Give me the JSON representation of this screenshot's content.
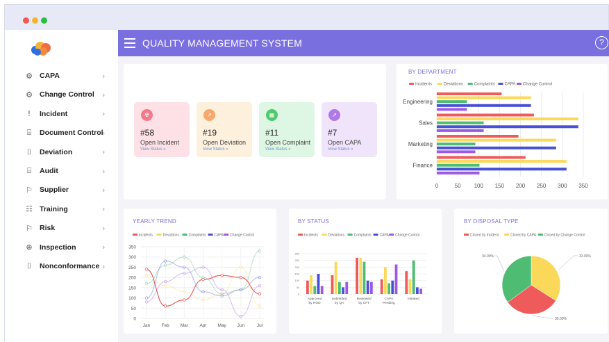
{
  "window": {
    "dots": [
      "#f05a4e",
      "#f5b52e",
      "#27c03f"
    ]
  },
  "header": {
    "title": "QUALITY MANAGEMENT SYSTEM",
    "help_symbol": "?"
  },
  "sidebar": {
    "items": [
      {
        "label": "CAPA",
        "icon": "gear-outline-icon"
      },
      {
        "label": "Change Control",
        "icon": "gear-icon"
      },
      {
        "label": "Incident",
        "icon": "exclamation-icon"
      },
      {
        "label": "Document Control",
        "icon": "document-icon"
      },
      {
        "label": "Deviation",
        "icon": "file-icon"
      },
      {
        "label": "Audit",
        "icon": "clipboard-icon"
      },
      {
        "label": "Supplier",
        "icon": "people-icon"
      },
      {
        "label": "Training",
        "icon": "chart-icon"
      },
      {
        "label": "Risk",
        "icon": "shield-icon"
      },
      {
        "label": "Inspection",
        "icon": "magnifier-icon"
      },
      {
        "label": "Nonconformance",
        "icon": "file-icon"
      }
    ]
  },
  "kpis": [
    {
      "count": "#58",
      "label": "Open Incident",
      "link": "View Status »",
      "bg": "#fde1e6",
      "icon_bg": "#f47a8b"
    },
    {
      "count": "#19",
      "label": "Open Deviation",
      "link": "View Status »",
      "bg": "#fdf0dc",
      "icon_bg": "#f8a86a"
    },
    {
      "count": "#11",
      "label": "Open Complaint",
      "link": "View Status »",
      "bg": "#ddf7e4",
      "icon_bg": "#4fc96d"
    },
    {
      "count": "#7",
      "label": "Open CAPA",
      "link": "View Status »",
      "bg": "#f0e4fb",
      "icon_bg": "#b07ae6"
    }
  ],
  "legend_colors": {
    "Incidents": "#ef5b5b",
    "Deviations": "#fad95a",
    "Complaints": "#4ebc72",
    "CAPA": "#4750d6",
    "Change Control": "#9d59e3"
  },
  "by_department": {
    "title": "BY DEPARTMENT",
    "series_names": [
      "Incidents",
      "Deviations",
      "Complaints",
      "CAPA",
      "Change Control"
    ],
    "x_ticks": [
      "0",
      "50",
      "100",
      "150",
      "200",
      "250",
      "300",
      "350"
    ],
    "chart_data": {
      "type": "bar",
      "orientation": "horizontal",
      "categories": [
        "Engineering",
        "Sales",
        "Marketing",
        "Finance"
      ],
      "series": [
        {
          "name": "Incidents",
          "values": [
            155,
            232,
            195,
            212
          ]
        },
        {
          "name": "Deviations",
          "values": [
            225,
            338,
            285,
            310
          ]
        },
        {
          "name": "Complaints",
          "values": [
            72,
            112,
            92,
            102
          ]
        },
        {
          "name": "CAPA",
          "values": [
            225,
            338,
            285,
            310
          ]
        },
        {
          "name": "Change Control",
          "values": [
            72,
            112,
            92,
            102
          ]
        }
      ],
      "xlim": [
        0,
        350
      ]
    }
  },
  "yearly_trend": {
    "title": "YEARLY TREND",
    "series_names": [
      "Incidents",
      "Deviations",
      "Complaints",
      "CAPA",
      "Change Control"
    ],
    "y_ticks": [
      "350",
      "300",
      "250",
      "200",
      "150",
      "100",
      "50",
      "0"
    ],
    "chart_data": {
      "type": "line",
      "categories": [
        "Jan",
        "Feb",
        "Mar",
        "Apr",
        "May",
        "Jun",
        "Jul"
      ],
      "series": [
        {
          "name": "Incidents",
          "values": [
            240,
            60,
            90,
            190,
            210,
            200,
            120
          ]
        },
        {
          "name": "Deviations",
          "values": [
            210,
            160,
            130,
            90,
            120,
            250,
            60
          ]
        },
        {
          "name": "Complaints",
          "values": [
            170,
            260,
            300,
            200,
            120,
            140,
            330
          ]
        },
        {
          "name": "CAPA",
          "values": [
            100,
            280,
            250,
            130,
            110,
            140,
            200
          ]
        },
        {
          "name": "Change Control",
          "values": [
            80,
            180,
            220,
            250,
            140,
            10,
            160
          ]
        }
      ],
      "ylim": [
        0,
        350
      ]
    }
  },
  "by_status": {
    "title": "BY STATUS",
    "series_names": [
      "Incidents",
      "Deviations",
      "Complaints",
      "CAPA",
      "Change Control"
    ],
    "y_ticks": [
      "300",
      "250",
      "200",
      "150",
      "100",
      "50",
      "0"
    ],
    "categories": [
      "Approved\nby HOD",
      "Submitted\nby QA",
      "Reviewed\nby CFT",
      "CAPA\nPending",
      "Initiated"
    ],
    "chart_data": {
      "type": "bar",
      "categories": [
        "Approved by HOD",
        "Submitted by QA",
        "Reviewed by CFT",
        "CAPA Pending",
        "Initiated"
      ],
      "series": [
        {
          "name": "Incidents",
          "values": [
            100,
            140,
            270,
            110,
            170
          ]
        },
        {
          "name": "Deviations",
          "values": [
            140,
            240,
            270,
            200,
            110
          ]
        },
        {
          "name": "Complaints",
          "values": [
            60,
            90,
            240,
            80,
            250
          ]
        },
        {
          "name": "CAPA",
          "values": [
            150,
            50,
            100,
            100,
            50
          ]
        },
        {
          "name": "Change Control",
          "values": [
            60,
            90,
            90,
            220,
            40
          ]
        }
      ],
      "ylim": [
        0,
        300
      ]
    }
  },
  "by_disposal": {
    "title": "BY DISPOSAL TYPE",
    "chart_data": {
      "type": "pie",
      "labels": [
        "Closed by Incident",
        "Closed by CAPA",
        "Closed by Change Control"
      ],
      "values": [
        30.0,
        33.0,
        34.0
      ],
      "value_labels": [
        "30.00%",
        "33.00%",
        "34.00%"
      ],
      "colors": [
        "#ef5b5b",
        "#fad95a",
        "#4ebc72"
      ]
    }
  }
}
